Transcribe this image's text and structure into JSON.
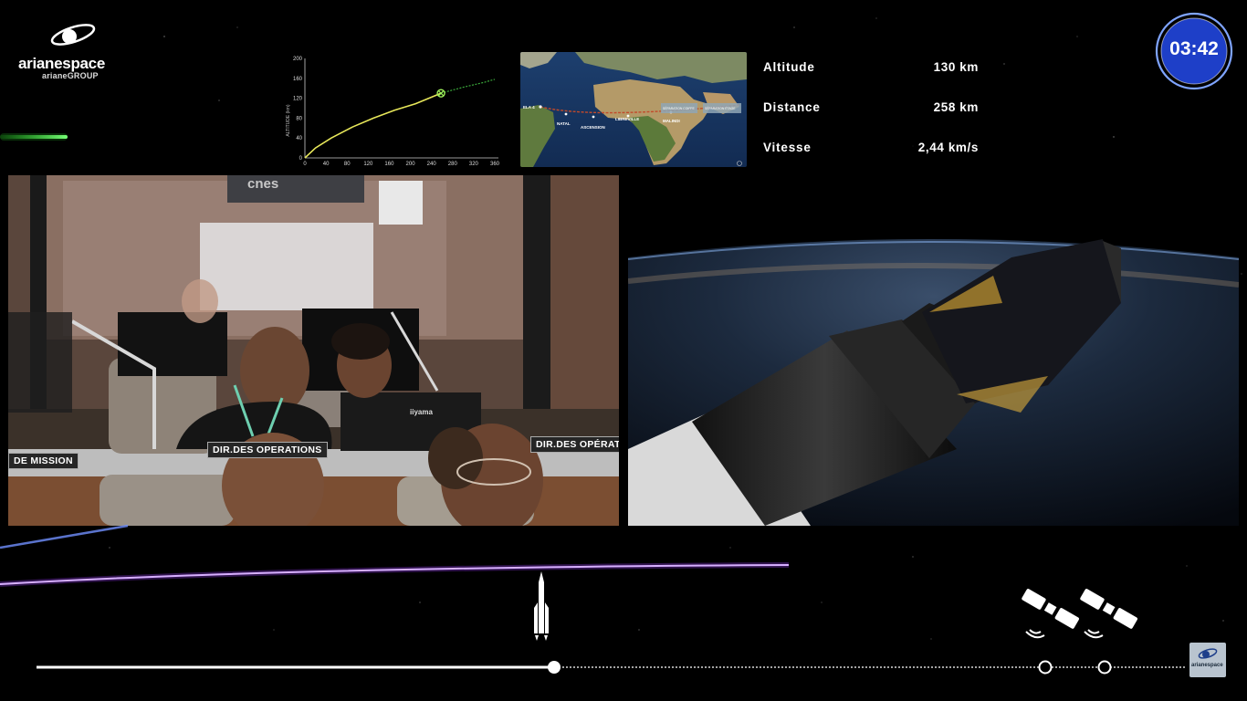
{
  "logo": {
    "brand": "arianespace",
    "sub": "arianeGROUP"
  },
  "trajectory": {
    "ylabel": "ALTITUDE (km)",
    "y_ticks": [
      "200",
      "160",
      "120",
      "80",
      "40",
      "0"
    ],
    "x_ticks": [
      "0",
      "40",
      "80",
      "120",
      "160",
      "200",
      "240",
      "280",
      "320",
      "360"
    ],
    "ylim": [
      0,
      200
    ],
    "xlim": [
      0,
      360
    ],
    "flown_path": [
      [
        0,
        0
      ],
      [
        20,
        20
      ],
      [
        50,
        40
      ],
      [
        90,
        62
      ],
      [
        130,
        80
      ],
      [
        170,
        96
      ],
      [
        210,
        109
      ],
      [
        258,
        130
      ]
    ],
    "planned_path": [
      [
        258,
        130
      ],
      [
        300,
        142
      ],
      [
        340,
        152
      ],
      [
        360,
        158
      ]
    ],
    "current_point": [
      258,
      130
    ],
    "colors": {
      "flown": "#e8e85a",
      "planned": "#3aa83a",
      "marker": "#9ef05a"
    }
  },
  "map": {
    "labels": [
      "ELA 4",
      "NATAL",
      "ASCENSION",
      "LIBREVILLE",
      "MALINDI"
    ],
    "boxes": [
      "SÉPARATION COIFFE",
      "SÉPARATION ÉTAGE"
    ]
  },
  "telemetry": [
    {
      "label": "Altitude",
      "value": "130 km"
    },
    {
      "label": "Distance",
      "value": "258 km"
    },
    {
      "label": "Vitesse",
      "value": "2,44 km/s"
    }
  ],
  "timer": {
    "value": "03:42",
    "ring_color": "#2a4fd8"
  },
  "control_room": {
    "signs": [
      "DE MISSION",
      "DIR.DES OPERATIONS",
      "DIR.DES OPÉRATI"
    ],
    "cnes_sign": "cnes",
    "monitor_brand": "iiyama"
  },
  "timeline": {
    "progress": 0.45,
    "milestones": 3,
    "colors": {
      "line": "#ffffff",
      "wave": "#a040ff"
    }
  }
}
